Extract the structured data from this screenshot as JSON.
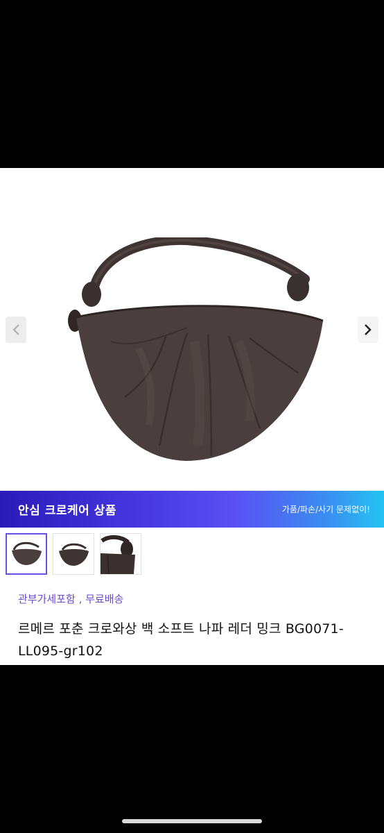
{
  "carousel": {
    "prev_icon": "chevron-left-icon",
    "next_icon": "chevron-right-icon"
  },
  "banner": {
    "title": "안심 크로케어 상품",
    "subtitle": "가품/파손/사기 문제없이!",
    "gradient_start": "#2a1bb8",
    "gradient_end": "#22c4f2"
  },
  "thumbnails": [
    {
      "label": "thumbnail-1",
      "selected": true
    },
    {
      "label": "thumbnail-2",
      "selected": false
    },
    {
      "label": "thumbnail-3",
      "selected": false
    }
  ],
  "product": {
    "badges": "관부가세포함 , 무료배송",
    "title": "르메르 포춘 크로와상 백 소프트 나파 레더 밍크 BG0071-LL095-gr102",
    "badge_color": "#6a4ccf"
  }
}
